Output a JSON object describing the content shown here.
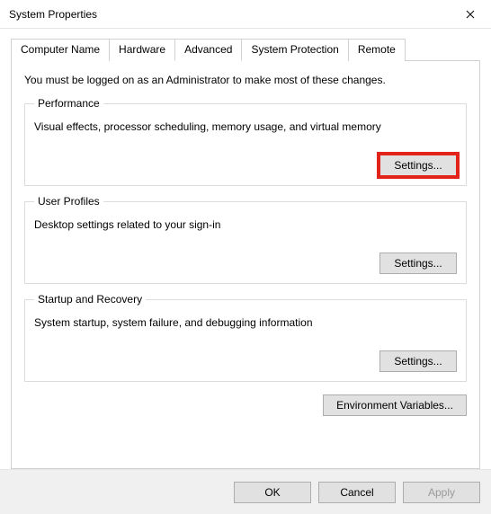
{
  "window": {
    "title": "System Properties"
  },
  "tabs": {
    "computer_name": "Computer Name",
    "hardware": "Hardware",
    "advanced": "Advanced",
    "system_protection": "System Protection",
    "remote": "Remote"
  },
  "advanced": {
    "intro": "You must be logged on as an Administrator to make most of these changes.",
    "performance": {
      "legend": "Performance",
      "desc": "Visual effects, processor scheduling, memory usage, and virtual memory",
      "button": "Settings..."
    },
    "user_profiles": {
      "legend": "User Profiles",
      "desc": "Desktop settings related to your sign-in",
      "button": "Settings..."
    },
    "startup_recovery": {
      "legend": "Startup and Recovery",
      "desc": "System startup, system failure, and debugging information",
      "button": "Settings..."
    },
    "env_button": "Environment Variables..."
  },
  "footer": {
    "ok": "OK",
    "cancel": "Cancel",
    "apply": "Apply"
  }
}
